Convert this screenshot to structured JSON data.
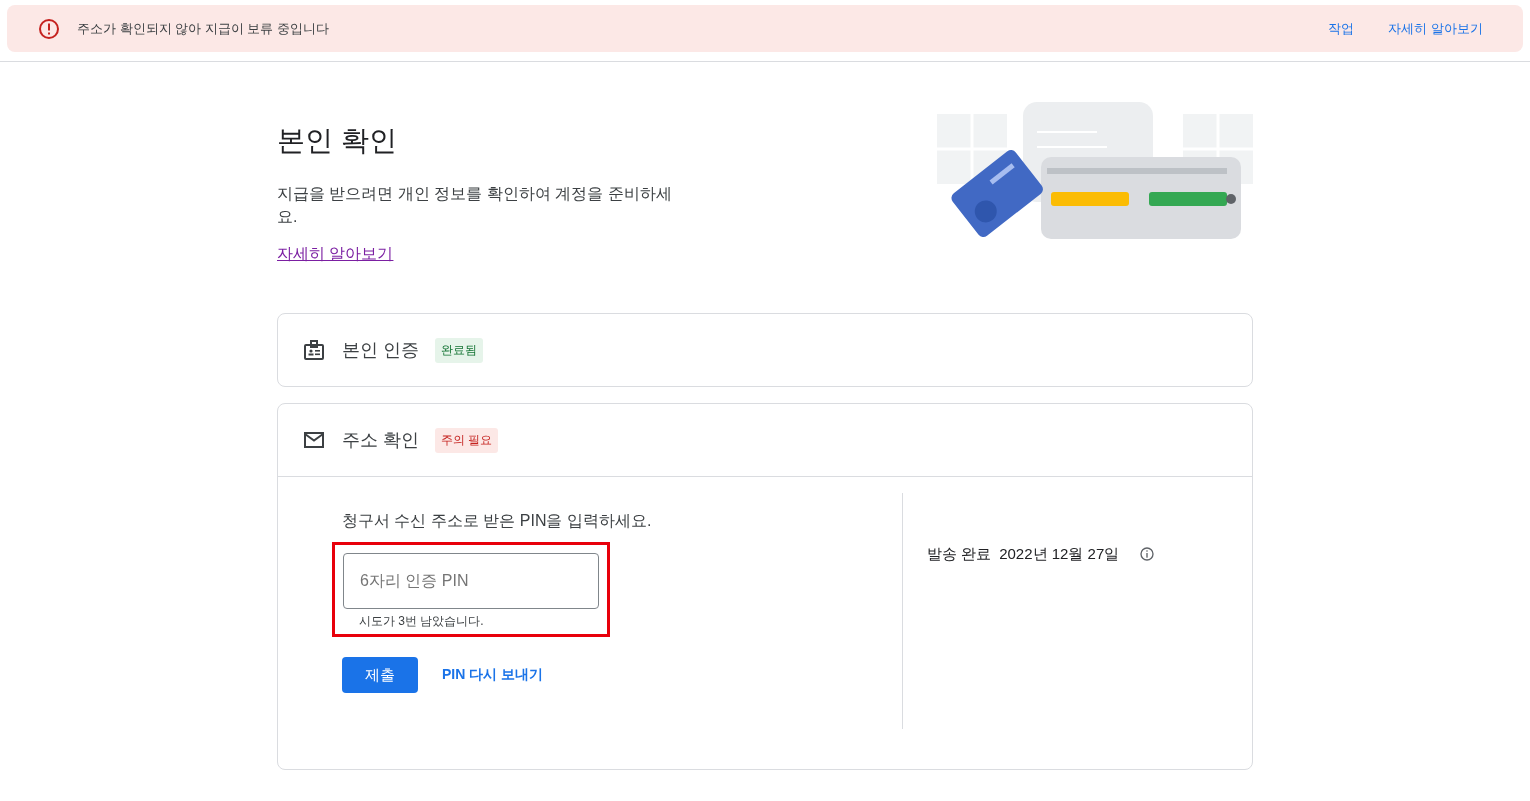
{
  "banner": {
    "message": "주소가 확인되지 않아 지급이 보류 중입니다",
    "actions": [
      "작업",
      "자세히 알아보기"
    ]
  },
  "header": {
    "title": "본인 확인",
    "description": "지급을 받으려면 개인 정보를 확인하여 계정을 준비하세요.",
    "link": "자세히 알아보기"
  },
  "sections": [
    {
      "kind": "identity",
      "title": "본인 인증",
      "status": {
        "label": "완료됨",
        "kind": "done"
      },
      "expanded": false
    },
    {
      "kind": "address",
      "title": "주소 확인",
      "status": {
        "label": "주의 필요",
        "kind": "warning"
      },
      "expanded": true,
      "prompt": "청구서 수신 주소로 받은 PIN을 입력하세요.",
      "pin_field": {
        "placeholder": "6자리 인증 PIN",
        "hint": "시도가 3번 남았습니다.",
        "highlighted": true
      },
      "submit": "제출",
      "resend": "PIN 다시 보내기",
      "sent_label": "발송 완료",
      "sent_date": "2022년 12월 27일"
    }
  ]
}
